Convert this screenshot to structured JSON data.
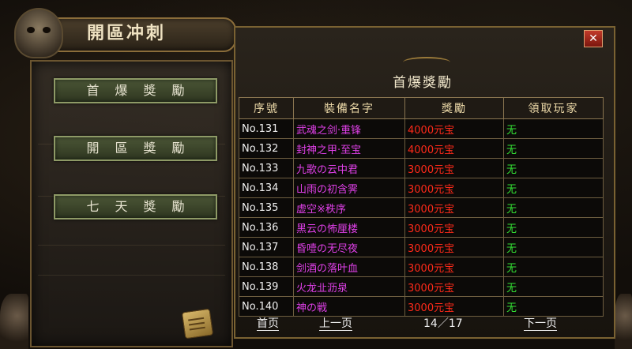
{
  "window": {
    "title": "開區冲刺",
    "close_label": "✕"
  },
  "nav": {
    "items": [
      {
        "label": "首爆獎勵"
      },
      {
        "label": "開區獎勵"
      },
      {
        "label": "七天獎勵"
      }
    ]
  },
  "panel": {
    "title": "首爆獎勵"
  },
  "table": {
    "headers": [
      "序號",
      "裝備名字",
      "獎勵",
      "領取玩家"
    ],
    "rows": [
      {
        "no": "No.131",
        "item": "武魂之剑·重锋",
        "reward": "4000元宝",
        "player": "无"
      },
      {
        "no": "No.132",
        "item": "封神之甲·至宝",
        "reward": "4000元宝",
        "player": "无"
      },
      {
        "no": "No.133",
        "item": "九歌の云中君",
        "reward": "3000元宝",
        "player": "无"
      },
      {
        "no": "No.134",
        "item": "山雨の初含霁",
        "reward": "3000元宝",
        "player": "无"
      },
      {
        "no": "No.135",
        "item": "虚空※秩序",
        "reward": "3000元宝",
        "player": "无"
      },
      {
        "no": "No.136",
        "item": "黑云の怖厘楼",
        "reward": "3000元宝",
        "player": "无"
      },
      {
        "no": "No.137",
        "item": "昏噎の无尽夜",
        "reward": "3000元宝",
        "player": "无"
      },
      {
        "no": "No.138",
        "item": "剑酒の落叶血",
        "reward": "3000元宝",
        "player": "无"
      },
      {
        "no": "No.139",
        "item": "火龙㐀沥泉",
        "reward": "3000元宝",
        "player": "无"
      },
      {
        "no": "No.140",
        "item": "神の戦",
        "reward": "3000元宝",
        "player": "无"
      }
    ]
  },
  "pager": {
    "first": "首页",
    "prev": "上一页",
    "page": "14／17",
    "next": "下一页"
  },
  "colors": {
    "item_name": "#e040e8",
    "reward": "#ff2a1a",
    "player": "#34e034"
  }
}
